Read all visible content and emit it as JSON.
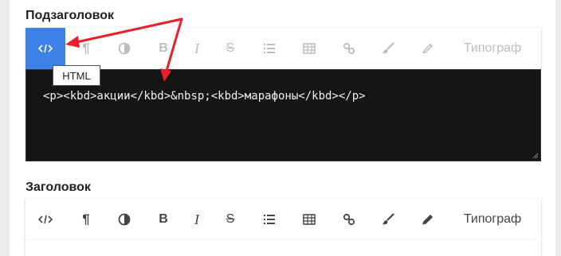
{
  "sections": [
    {
      "label": "Подзаголовок",
      "toolbar": {
        "buttons": [
          {
            "name": "html",
            "icon": "code-icon"
          },
          {
            "name": "paragraph",
            "icon": "pilcrow-icon",
            "glyph": "¶"
          },
          {
            "name": "contrast",
            "icon": "contrast-icon"
          },
          {
            "name": "bold",
            "icon": "bold-icon",
            "glyph": "B"
          },
          {
            "name": "italic",
            "icon": "italic-icon",
            "glyph": "I"
          },
          {
            "name": "strike",
            "icon": "strikethrough-icon",
            "glyph": "S"
          },
          {
            "name": "list",
            "icon": "list-icon"
          },
          {
            "name": "table",
            "icon": "table-icon"
          },
          {
            "name": "link",
            "icon": "link-icon"
          },
          {
            "name": "brush",
            "icon": "brush-icon"
          },
          {
            "name": "pencil",
            "icon": "pencil-icon"
          }
        ],
        "typograf_label": "Типограф"
      },
      "tooltip": "HTML",
      "code_content": "<p><kbd>акции</kbd>&nbsp;<kbd>марафоны</kbd></p>"
    },
    {
      "label": "Заголовок",
      "toolbar": {
        "glyphs": {
          "paragraph": "¶",
          "bold": "B",
          "italic": "I",
          "strike": "S"
        },
        "typograf_label": "Типограф"
      }
    }
  ],
  "colors": {
    "active_button": "#3d82e8",
    "annotation_arrow": "#e8202a",
    "code_background": "#151515",
    "code_text": "#f2f2f2"
  }
}
